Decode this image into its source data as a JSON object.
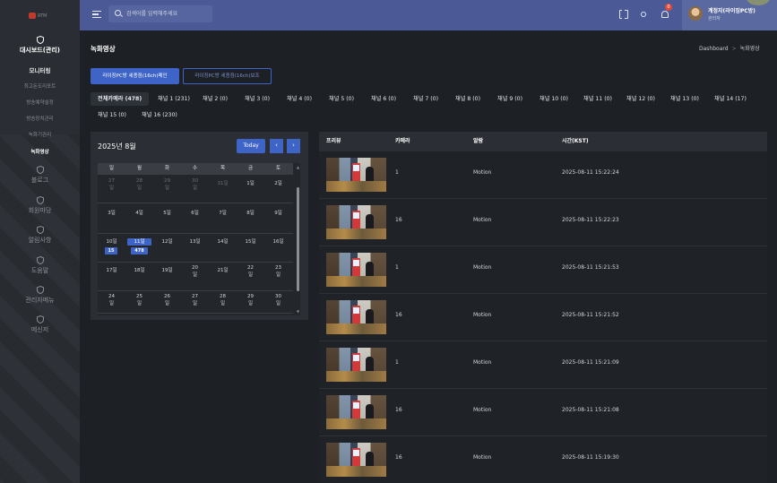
{
  "sidebar": {
    "logo_text": "RTM",
    "dashboard_title": "대시보드(관리)",
    "monitoring": "모니터링",
    "items": [
      {
        "label": "최고돈도리포트",
        "active": false
      },
      {
        "label": "방송예약설정",
        "active": false
      },
      {
        "label": "방송장치관리",
        "active": false
      },
      {
        "label": "녹화기관리",
        "active": false
      },
      {
        "label": "녹화영상",
        "active": true
      }
    ],
    "groups": [
      "블로그",
      "회원마당",
      "알림사항",
      "도움말",
      "관리자메뉴",
      "메신저"
    ]
  },
  "topbar": {
    "search_placeholder": "검색어를 입력해주세요",
    "notification_count": "0",
    "user_name": "계정자(라이징PC방)",
    "user_role": "관리자"
  },
  "page": {
    "title": "녹화영상",
    "breadcrumb_home": "Dashboard",
    "breadcrumb_sep": ">",
    "breadcrumb_current": "녹화영상"
  },
  "buttons": {
    "primary": "라이징PC방 세종점(16ch)메인",
    "secondary": "라이징PC방 세종점(16ch)보조"
  },
  "tabs": [
    {
      "label": "전체카메라 (478)",
      "active": true
    },
    {
      "label": "채널 1 (231)"
    },
    {
      "label": "채널 2 (0)"
    },
    {
      "label": "채널 3 (0)"
    },
    {
      "label": "채널 4 (0)"
    },
    {
      "label": "채널 5 (0)"
    },
    {
      "label": "채널 6 (0)"
    },
    {
      "label": "채널 7 (0)"
    },
    {
      "label": "채널 8 (0)"
    },
    {
      "label": "채널 9 (0)"
    },
    {
      "label": "채널 10 (0)"
    },
    {
      "label": "채널 11 (0)"
    },
    {
      "label": "채널 12 (0)"
    },
    {
      "label": "채널 13 (0)"
    },
    {
      "label": "채널 14 (17)"
    },
    {
      "label": "채널 15 (0)"
    },
    {
      "label": "채널 16 (230)"
    }
  ],
  "calendar": {
    "month_label": "2025년 8월",
    "today_label": "Today",
    "prev_label": "‹",
    "next_label": "›",
    "weekdays": [
      "일",
      "월",
      "화",
      "수",
      "목",
      "금",
      "토"
    ],
    "weeks": [
      [
        {
          "l1": "27",
          "l2": "일",
          "muted": true
        },
        {
          "l1": "28",
          "l2": "일",
          "muted": true
        },
        {
          "l1": "29",
          "l2": "일",
          "muted": true
        },
        {
          "l1": "30",
          "l2": "일",
          "muted": true
        },
        {
          "l1": "31일",
          "muted": true
        },
        {
          "l1": "1일"
        },
        {
          "l1": "2일"
        }
      ],
      [
        {
          "l1": "3일"
        },
        {
          "l1": "4일"
        },
        {
          "l1": "5일"
        },
        {
          "l1": "6일"
        },
        {
          "l1": "7일"
        },
        {
          "l1": "8일"
        },
        {
          "l1": "9일"
        }
      ],
      [
        {
          "l1": "10일"
        },
        {
          "l1": "11일",
          "sel": true
        },
        {
          "l1": "12일"
        },
        {
          "l1": "13일"
        },
        {
          "l1": "14일"
        },
        {
          "l1": "15일"
        },
        {
          "l1": "16일"
        }
      ],
      [
        {
          "l1": "17일"
        },
        {
          "l1": "18일"
        },
        {
          "l1": "19일"
        },
        {
          "l1": "20",
          "l2": "일"
        },
        {
          "l1": "21일"
        },
        {
          "l1": "22",
          "l2": "일"
        },
        {
          "l1": "23",
          "l2": "일"
        }
      ],
      [
        {
          "l1": "24",
          "l2": "일"
        },
        {
          "l1": "25",
          "l2": "일"
        },
        {
          "l1": "26",
          "l2": "일"
        },
        {
          "l1": "27",
          "l2": "일"
        },
        {
          "l1": "28",
          "l2": "일"
        },
        {
          "l1": "29",
          "l2": "일"
        },
        {
          "l1": "30",
          "l2": "일"
        }
      ],
      [
        {
          "l1": "31일"
        },
        {
          "l1": "1일",
          "muted": true
        },
        {
          "l1": "2일",
          "muted": true
        },
        {
          "l1": "3일",
          "muted": true
        },
        {
          "l1": "4일",
          "muted": true
        },
        {
          "l1": "5일",
          "muted": true
        },
        {
          "l1": "6일",
          "muted": true
        }
      ]
    ],
    "events": [
      {
        "label": "15",
        "week": 2,
        "col": 0
      },
      {
        "label": "478",
        "week": 2,
        "col": 1
      }
    ]
  },
  "table": {
    "headers": [
      "프리뷰",
      "카메라",
      "알람",
      "시간(KST)"
    ],
    "rows": [
      {
        "camera": "1",
        "alarm": "Motion",
        "time": "2025-08-11 15:22:24"
      },
      {
        "camera": "16",
        "alarm": "Motion",
        "time": "2025-08-11 15:22:23"
      },
      {
        "camera": "1",
        "alarm": "Motion",
        "time": "2025-08-11 15:21:53"
      },
      {
        "camera": "16",
        "alarm": "Motion",
        "time": "2025-08-11 15:21:52"
      },
      {
        "camera": "1",
        "alarm": "Motion",
        "time": "2025-08-11 15:21:09"
      },
      {
        "camera": "16",
        "alarm": "Motion",
        "time": "2025-08-11 15:21:08"
      },
      {
        "camera": "16",
        "alarm": "Motion",
        "time": "2025-08-11 15:19:30"
      }
    ]
  },
  "colors": {
    "accent": "#3f64c8",
    "topbar": "#4b5a96",
    "badge": "#e04a3a"
  }
}
